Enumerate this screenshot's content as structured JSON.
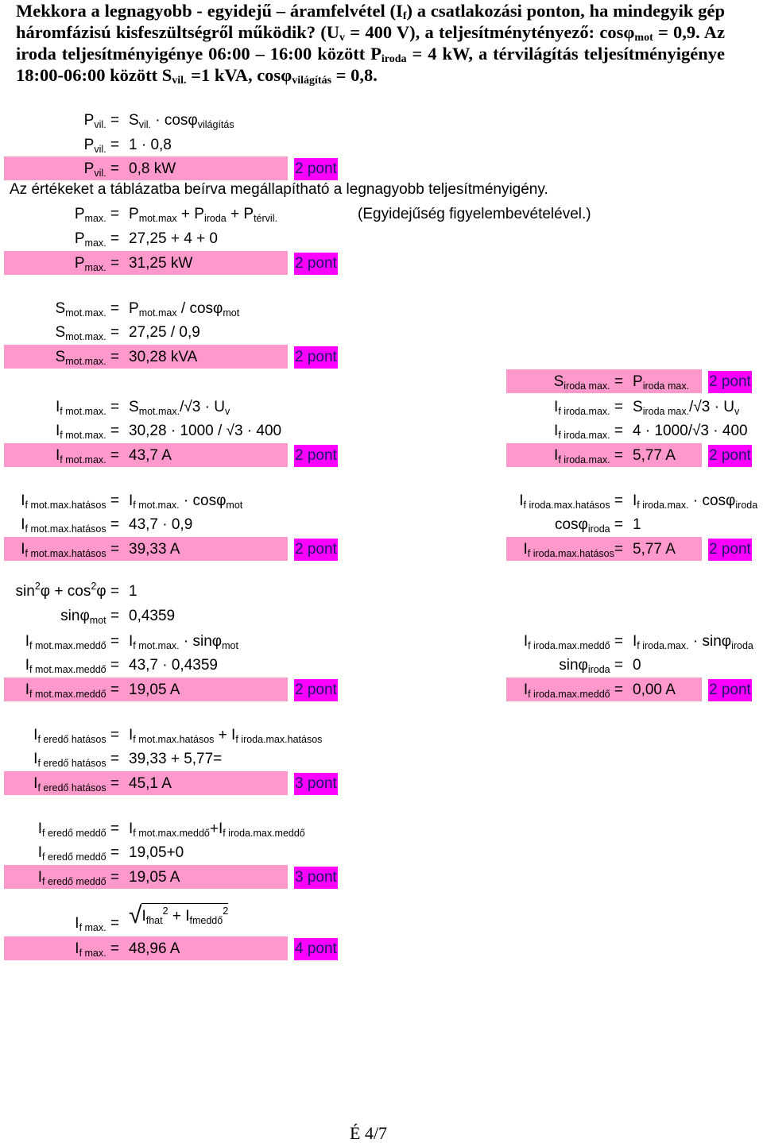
{
  "colors": {
    "highlight": "#ff99cc",
    "points_badge": "#ff00ff"
  },
  "question": [
    "Mekkora a legnagyobb - egyidejű – áramfelvétel (I",
    {
      "sub": "f"
    },
    ") a csatlakozási ponton, ha mindegyik gép háromfázisú kisfeszültségről működik? (U",
    {
      "sub": "v"
    },
    " = 400 V), a teljesítménytényező: cosφ",
    {
      "sub": "mot"
    },
    " = 0,9. Az iroda teljesítményigénye 06:00 – 16:00 között P",
    {
      "sub": "iroda"
    },
    " = 4 kW, a térvilágítás teljesítményigénye 18:00-06:00 között S",
    {
      "sub": "vil."
    },
    " =1 kVA, cosφ",
    {
      "sub": "világítás"
    },
    " = 0,8."
  ],
  "paragraph": "Az értékeket a táblázatba beírva megállapítható a legnagyobb teljesítményigény.",
  "note": "(Egyidejűség figyelembevételével.)",
  "footer": "É 4/7",
  "left_column": [
    {
      "label": [
        "P",
        {
          "sub": "vil."
        },
        " ="
      ],
      "value": [
        "S",
        {
          "sub": "vil."
        },
        " · cosφ",
        {
          "sub": "világítás"
        }
      ]
    },
    {
      "label": [
        "P",
        {
          "sub": "vil."
        },
        " ="
      ],
      "value": [
        "1 · 0,8"
      ]
    },
    {
      "label": [
        "P",
        {
          "sub": "vil."
        },
        " ="
      ],
      "value": [
        "0,8 kW"
      ],
      "highlight": true,
      "points": "2 pont"
    },
    {
      "label": [
        "P",
        {
          "sub": "max."
        },
        " ="
      ],
      "value": [
        "P",
        {
          "sub": "mot.max"
        },
        " + P",
        {
          "sub": "iroda"
        },
        " + P",
        {
          "sub": "térvil."
        }
      ]
    },
    {
      "label": [
        "P",
        {
          "sub": "max."
        },
        " ="
      ],
      "value": [
        "27,25 + 4 + 0"
      ]
    },
    {
      "label": [
        "P",
        {
          "sub": "max."
        },
        " ="
      ],
      "value": [
        "31,25 kW"
      ],
      "highlight": true,
      "points": "2 pont"
    },
    {
      "label": [
        "S",
        {
          "sub": "mot.max."
        },
        " ="
      ],
      "value": [
        "P",
        {
          "sub": "mot.max"
        },
        " / cosφ",
        {
          "sub": "mot"
        }
      ]
    },
    {
      "label": [
        "S",
        {
          "sub": "mot.max."
        },
        " ="
      ],
      "value": [
        "27,25 / 0,9"
      ]
    },
    {
      "label": [
        "S",
        {
          "sub": "mot.max."
        },
        " ="
      ],
      "value": [
        "30,28 kVA"
      ],
      "highlight": true,
      "points": "2 pont"
    },
    {
      "label": [
        "I",
        {
          "sub": "f mot.max."
        },
        " ="
      ],
      "value": [
        "S",
        {
          "sub": "mot.max."
        },
        "/√3 · U",
        {
          "sub": "v"
        }
      ]
    },
    {
      "label": [
        "I",
        {
          "sub": "f mot.max."
        },
        " ="
      ],
      "value": [
        "30,28 · 1000 / √3 · 400"
      ]
    },
    {
      "label": [
        "I",
        {
          "sub": "f mot.max."
        },
        " ="
      ],
      "value": [
        "43,7 A"
      ],
      "highlight": true,
      "points": "2 pont"
    },
    {
      "label": [
        "I",
        {
          "sub": "f mot.max.hatásos"
        },
        " ="
      ],
      "value": [
        "I",
        {
          "sub": "f mot.max."
        },
        " · cosφ",
        {
          "sub": "mot"
        }
      ]
    },
    {
      "label": [
        "I",
        {
          "sub": "f mot.max.hatásos"
        },
        " ="
      ],
      "value": [
        "43,7 · 0,9"
      ]
    },
    {
      "label": [
        "I",
        {
          "sub": "f mot.max.hatásos"
        },
        " ="
      ],
      "value": [
        "39,33 A"
      ],
      "highlight": true,
      "points": "2 pont"
    },
    {
      "label": [
        "sin",
        {
          "sup": "2"
        },
        "φ + cos",
        {
          "sup": "2"
        },
        "φ ="
      ],
      "value": [
        "1"
      ]
    },
    {
      "label": [
        "sinφ",
        {
          "sub": "mot"
        },
        " ="
      ],
      "value": [
        "0,4359"
      ]
    },
    {
      "label": [
        "I",
        {
          "sub": "f mot.max.meddő"
        },
        " ="
      ],
      "value": [
        "I",
        {
          "sub": "f mot.max."
        },
        " · sinφ",
        {
          "sub": "mot"
        }
      ]
    },
    {
      "label": [
        "I",
        {
          "sub": "f mot.max.meddő"
        },
        " ="
      ],
      "value": [
        "43,7 · 0,4359"
      ]
    },
    {
      "label": [
        "I",
        {
          "sub": "f mot.max.meddő"
        },
        " ="
      ],
      "value": [
        "19,05 A"
      ],
      "highlight": true,
      "points": "2 pont"
    },
    {
      "label": [
        "I",
        {
          "sub": "f eredő hatásos"
        },
        " ="
      ],
      "value": [
        "I",
        {
          "sub": "f mot.max.hatásos"
        },
        " + I",
        {
          "sub": "f iroda.max.hatásos"
        }
      ]
    },
    {
      "label": [
        "I",
        {
          "sub": "f eredő hatásos"
        },
        " ="
      ],
      "value": [
        "39,33 + 5,77="
      ]
    },
    {
      "label": [
        "I",
        {
          "sub": "f eredő hatásos"
        },
        " ="
      ],
      "value": [
        "45,1 A"
      ],
      "highlight": true,
      "points": "3 pont"
    },
    {
      "label": [
        "I",
        {
          "sub": "f eredő meddő"
        },
        " ="
      ],
      "value": [
        "I",
        {
          "sub": "f mot.max.meddő"
        },
        "+I",
        {
          "sub": "f iroda.max.meddő"
        }
      ]
    },
    {
      "label": [
        "I",
        {
          "sub": "f eredő meddő"
        },
        " ="
      ],
      "value": [
        "19,05+0"
      ]
    },
    {
      "label": [
        "I",
        {
          "sub": "f eredő meddő"
        },
        " ="
      ],
      "value": [
        "19,05 A"
      ],
      "highlight": true,
      "points": "3 pont"
    },
    {
      "label": [
        "I",
        {
          "sub": "f max."
        },
        " ="
      ],
      "value": [
        {
          "sqrt": [
            "I",
            {
              "sub": "fhat"
            },
            {
              "sup": "2"
            },
            " + I",
            {
              "sub": "fmeddő"
            },
            {
              "sup": "2"
            }
          ]
        }
      ]
    },
    {
      "label": [
        "I",
        {
          "sub": "f max."
        },
        " ="
      ],
      "value": [
        "48,96 A"
      ],
      "highlight": true,
      "points": "4 pont"
    }
  ],
  "right_column": [
    {
      "label": [
        "S",
        {
          "sub": "iroda max."
        },
        " ="
      ],
      "value": [
        "P",
        {
          "sub": "iroda max."
        }
      ],
      "highlight": true,
      "points": "2 pont"
    },
    {
      "label": [
        "I",
        {
          "sub": "f iroda.max."
        },
        " ="
      ],
      "value": [
        "S",
        {
          "sub": "iroda max."
        },
        "/√3 · U",
        {
          "sub": "v"
        }
      ]
    },
    {
      "label": [
        "I",
        {
          "sub": "f iroda.max."
        },
        " ="
      ],
      "value": [
        "4 · 1000/√3 · 400"
      ]
    },
    {
      "label": [
        "I",
        {
          "sub": "f iroda.max."
        },
        " ="
      ],
      "value": [
        "5,77 A"
      ],
      "highlight": true,
      "points": "2 pont"
    },
    {
      "label": [
        "I",
        {
          "sub": "f iroda.max.hatásos"
        },
        " ="
      ],
      "value": [
        "I",
        {
          "sub": "f iroda.max."
        },
        " · cosφ",
        {
          "sub": "iroda"
        }
      ]
    },
    {
      "label": [
        "cosφ",
        {
          "sub": "iroda"
        },
        " ="
      ],
      "value": [
        "1"
      ]
    },
    {
      "label": [
        "I",
        {
          "sub": "f iroda.max.hatásos"
        },
        "="
      ],
      "value": [
        "5,77 A"
      ],
      "highlight": true,
      "points": "2 pont"
    },
    {
      "label": [
        "I",
        {
          "sub": "f iroda.max.meddő"
        },
        " ="
      ],
      "value": [
        "I",
        {
          "sub": "f iroda.max."
        },
        " · sinφ",
        {
          "sub": "iroda"
        }
      ]
    },
    {
      "label": [
        "sinφ",
        {
          "sub": "iroda"
        },
        " ="
      ],
      "value": [
        "0"
      ]
    },
    {
      "label": [
        "I",
        {
          "sub": "f iroda.max.meddő"
        },
        " ="
      ],
      "value": [
        "0,00 A"
      ],
      "highlight": true,
      "points": "2 pont"
    }
  ]
}
